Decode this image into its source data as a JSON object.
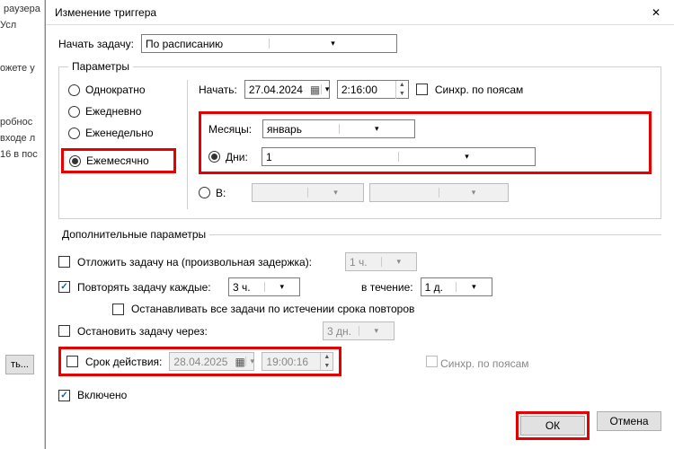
{
  "bg": {
    "title_frag": "раузера",
    "tab_conditions": "Усл",
    "text1": "ожете у",
    "text2": "робнос",
    "text3": "входе л",
    "text4": "16 в пос",
    "edit_btn": "ть..."
  },
  "dialog": {
    "title": "Изменение триггера"
  },
  "begin": {
    "label": "Начать задачу:",
    "value": "По расписанию"
  },
  "params": {
    "legend": "Параметры",
    "once": "Однократно",
    "daily": "Ежедневно",
    "weekly": "Еженедельно",
    "monthly": "Ежемесячно",
    "start_label": "Начать:",
    "start_date": "27.04.2024",
    "start_time": "2:16:00",
    "sync_tz": "Синхр. по поясам",
    "months_label": "Месяцы:",
    "months_value": "январь",
    "days_label": "Дни:",
    "days_value": "1",
    "on_label": "В:"
  },
  "addl": {
    "legend": "Дополнительные параметры",
    "delay_label": "Отложить задачу на (произвольная задержка):",
    "delay_value": "1 ч.",
    "repeat_label": "Повторять задачу каждые:",
    "repeat_value": "3 ч.",
    "repeat_for_label": "в течение:",
    "repeat_for_value": "1 д.",
    "stop_all": "Останавливать все задачи по истечении срока повторов",
    "stop_after_label": "Остановить задачу через:",
    "stop_after_value": "3 дн.",
    "expire_label": "Срок действия:",
    "expire_date": "28.04.2025",
    "expire_time": "19:00:16",
    "expire_sync": "Синхр. по поясам",
    "enabled": "Включено"
  },
  "buttons": {
    "ok": "ОК",
    "cancel": "Отмена"
  }
}
